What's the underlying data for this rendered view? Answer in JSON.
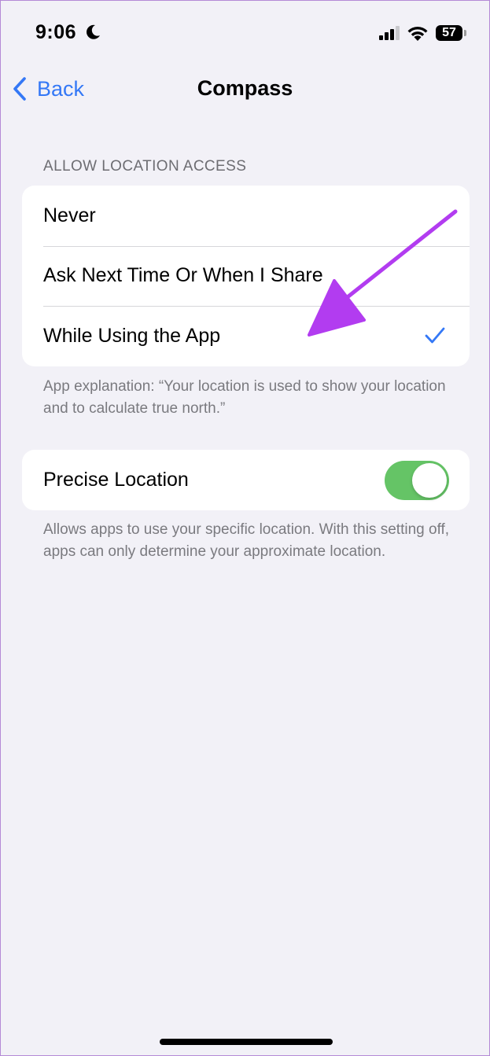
{
  "status_bar": {
    "time": "9:06",
    "battery_level": "57",
    "icons": [
      "moon-icon",
      "signal-icon",
      "wifi-icon",
      "battery-icon"
    ]
  },
  "nav": {
    "back_label": "Back",
    "title": "Compass"
  },
  "location_access": {
    "header": "ALLOW LOCATION ACCESS",
    "options": [
      {
        "label": "Never",
        "selected": false
      },
      {
        "label": "Ask Next Time Or When I Share",
        "selected": false
      },
      {
        "label": "While Using the App",
        "selected": true
      }
    ],
    "footer": "App explanation: “Your location is used to show your location and to calculate true north.”"
  },
  "precise_location": {
    "label": "Precise Location",
    "enabled": true,
    "footer": "Allows apps to use your specific location. With this setting off, apps can only determine your approximate location."
  },
  "colors": {
    "accent": "#3478f6",
    "toggle_on": "#65c466",
    "annotation_arrow": "#b23cf0",
    "background": "#f2f1f7"
  }
}
